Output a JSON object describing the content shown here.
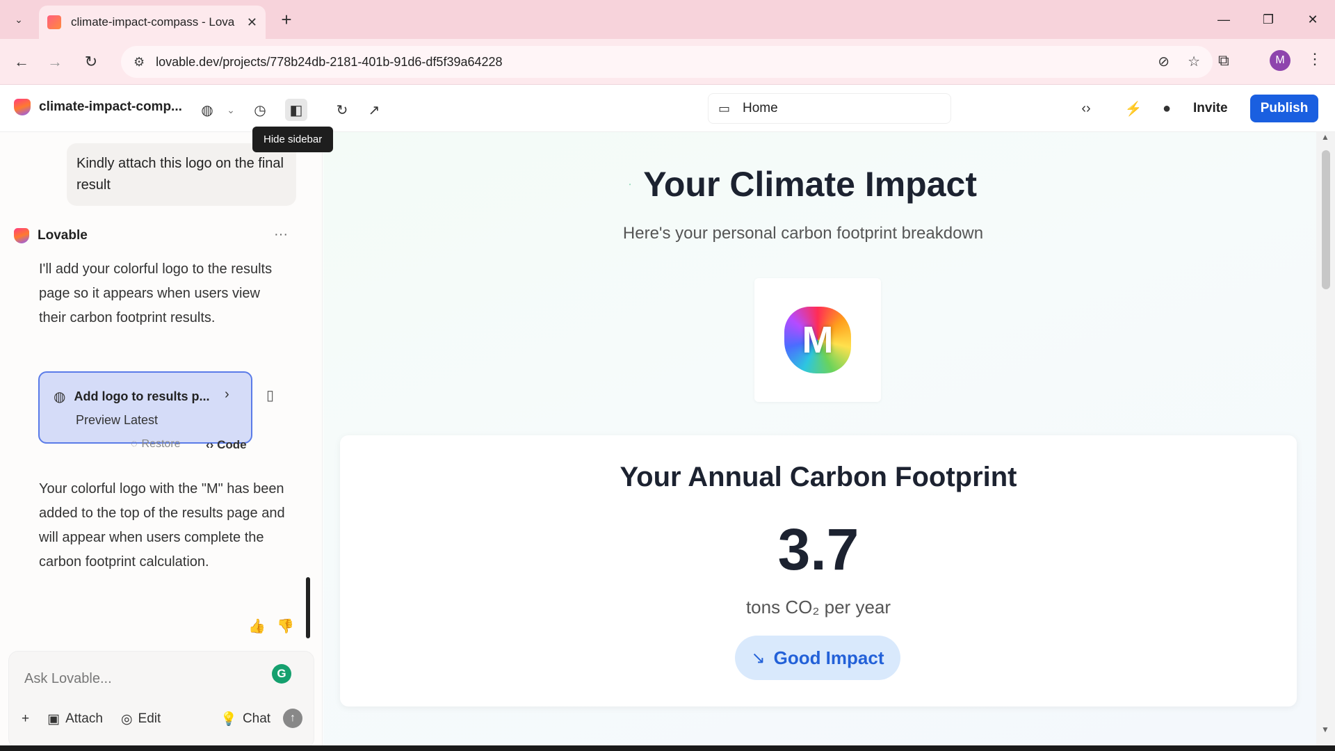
{
  "browser": {
    "tab_title": "climate-impact-compass - Lova",
    "url": "lovable.dev/projects/778b24db-2181-401b-91d6-df5f39a64228",
    "profile_initial": "M"
  },
  "app": {
    "project_name": "climate-impact-comp...",
    "tooltip": "Hide sidebar",
    "page_selector": "Home",
    "invite_label": "Invite",
    "publish_label": "Publish",
    "accent_color": "#1a5fe0"
  },
  "chat": {
    "user_message": "Kindly attach this logo on the final result",
    "assistant_name": "Lovable",
    "assistant_message_1": "I'll add your colorful logo to the results page so it appears when users view their carbon footprint results.",
    "card_title": "Add logo to results p...",
    "card_action": "Preview Latest",
    "restore_label": "Restore",
    "code_label": "Code",
    "assistant_message_2": "Your colorful logo with the \"M\" has been added to the top of the results page and will appear when users complete the carbon footprint calculation.",
    "input_placeholder": "Ask Lovable...",
    "attach_label": "Attach",
    "edit_label": "Edit",
    "chat_label": "Chat"
  },
  "preview": {
    "heading": "Your Climate Impact",
    "subheading": "Here's your personal carbon footprint breakdown",
    "logo_letter": "M",
    "card_title": "Your Annual Carbon Footprint",
    "value": "3.7",
    "unit": "tons CO₂ per year",
    "impact_label": "Good Impact",
    "impact_color": "#2361d8"
  }
}
